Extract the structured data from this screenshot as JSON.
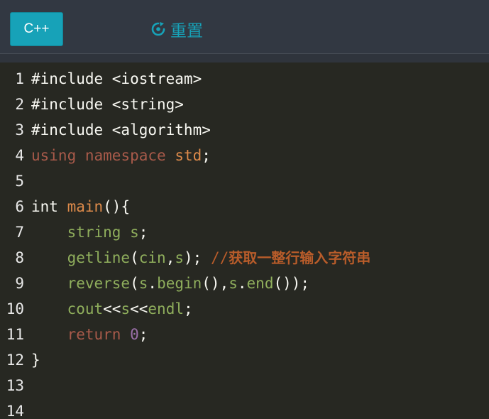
{
  "toolbar": {
    "language_label": "C++",
    "reset_label": "重置",
    "accent_color": "#17a2b8"
  },
  "editor": {
    "lines": [
      {
        "n": "1",
        "tokens": [
          {
            "t": "#include <iostream>",
            "c": "default"
          }
        ]
      },
      {
        "n": "2",
        "tokens": [
          {
            "t": "#include <string>",
            "c": "default"
          }
        ]
      },
      {
        "n": "3",
        "tokens": [
          {
            "t": "#include <algorithm>",
            "c": "default"
          }
        ]
      },
      {
        "n": "4",
        "tokens": [
          {
            "t": "using",
            "c": "keyword"
          },
          {
            "t": " ",
            "c": "default"
          },
          {
            "t": "namespace",
            "c": "keyword"
          },
          {
            "t": " ",
            "c": "default"
          },
          {
            "t": "std",
            "c": "func"
          },
          {
            "t": ";",
            "c": "default"
          }
        ]
      },
      {
        "n": "5",
        "tokens": []
      },
      {
        "n": "6",
        "tokens": [
          {
            "t": "int ",
            "c": "default"
          },
          {
            "t": "main",
            "c": "func"
          },
          {
            "t": "(){",
            "c": "default"
          }
        ]
      },
      {
        "n": "7",
        "tokens": [
          {
            "t": "    ",
            "c": "default"
          },
          {
            "t": "string",
            "c": "var"
          },
          {
            "t": " ",
            "c": "default"
          },
          {
            "t": "s",
            "c": "var"
          },
          {
            "t": ";",
            "c": "default"
          }
        ]
      },
      {
        "n": "8",
        "tokens": [
          {
            "t": "    ",
            "c": "default"
          },
          {
            "t": "getline",
            "c": "var"
          },
          {
            "t": "(",
            "c": "default"
          },
          {
            "t": "cin",
            "c": "var"
          },
          {
            "t": ",",
            "c": "default"
          },
          {
            "t": "s",
            "c": "var"
          },
          {
            "t": "); ",
            "c": "default"
          },
          {
            "t": "//",
            "c": "comment"
          },
          {
            "t": "获取一整行输入字符串",
            "c": "comment-cjk"
          }
        ]
      },
      {
        "n": "9",
        "tokens": [
          {
            "t": "    ",
            "c": "default"
          },
          {
            "t": "reverse",
            "c": "var"
          },
          {
            "t": "(",
            "c": "default"
          },
          {
            "t": "s",
            "c": "var"
          },
          {
            "t": ".",
            "c": "default"
          },
          {
            "t": "begin",
            "c": "var"
          },
          {
            "t": "(),",
            "c": "default"
          },
          {
            "t": "s",
            "c": "var"
          },
          {
            "t": ".",
            "c": "default"
          },
          {
            "t": "end",
            "c": "var"
          },
          {
            "t": "());",
            "c": "default"
          }
        ]
      },
      {
        "n": "10",
        "tokens": [
          {
            "t": "    ",
            "c": "default"
          },
          {
            "t": "cout",
            "c": "var"
          },
          {
            "t": "<<",
            "c": "default"
          },
          {
            "t": "s",
            "c": "var"
          },
          {
            "t": "<<",
            "c": "default"
          },
          {
            "t": "endl",
            "c": "var"
          },
          {
            "t": ";",
            "c": "default"
          }
        ]
      },
      {
        "n": "11",
        "tokens": [
          {
            "t": "    ",
            "c": "default"
          },
          {
            "t": "return",
            "c": "keyword"
          },
          {
            "t": " ",
            "c": "default"
          },
          {
            "t": "0",
            "c": "number"
          },
          {
            "t": ";",
            "c": "default"
          }
        ]
      },
      {
        "n": "12",
        "tokens": [
          {
            "t": "}",
            "c": "default"
          }
        ]
      },
      {
        "n": "13",
        "tokens": []
      },
      {
        "n": "14",
        "tokens": []
      }
    ]
  }
}
